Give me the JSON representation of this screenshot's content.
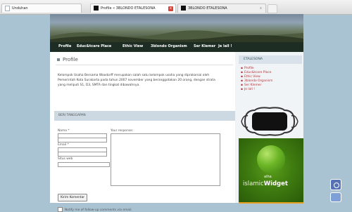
{
  "browser": {
    "tabs": [
      {
        "label": "Unduhan",
        "icon": "document-icon"
      },
      {
        "label": "Profile « 3BLONDO ETALESONA",
        "icon": "black-square-icon"
      },
      {
        "label": "3BLONDO ETALESONA",
        "icon": "black-square-icon"
      }
    ],
    "close_glyph": "x"
  },
  "nav": {
    "items": [
      "Profile",
      "Educ&tcare Place",
      "Ethic View",
      "3blondo Organism",
      "Ser Klemer",
      "Je lalI !"
    ]
  },
  "main": {
    "title": "Profile",
    "body": "Kelompok Usaha Bersama Woodorff merupakan salah satu kelompok usaha yang diprakarsai oleh Pemerintah Kota Surakarta pada tahun 2007 november yang beranggotakan 20 orang, dengan strata yang meliputi S1, D3, SMTA dan tingkat dibawahnya.",
    "comment_heading": "BERI TANGGAPAN",
    "form": {
      "name_label": "Nama *",
      "email_label": "Email *",
      "site_label": "Situs web",
      "response_label": "Your response:",
      "submit_label": "Kirim Komentar",
      "notify_label": "Notify me of follow-up comments via email."
    }
  },
  "sidebar": {
    "title": "ETALESONA",
    "links": [
      "Profile",
      "Educ&tcare Place",
      "Ethic View",
      "3blondo Organism",
      "Ser Klemer",
      "Je lalI !"
    ],
    "widget": {
      "top": "alha",
      "text_light": "islamic",
      "text_bold": "Widget"
    }
  },
  "colors": {
    "accent_link": "#b8323a",
    "nav_bg": "#1d2d24",
    "desktop_bg": "#a9c3d3",
    "widget_green": "#3f7c10"
  }
}
